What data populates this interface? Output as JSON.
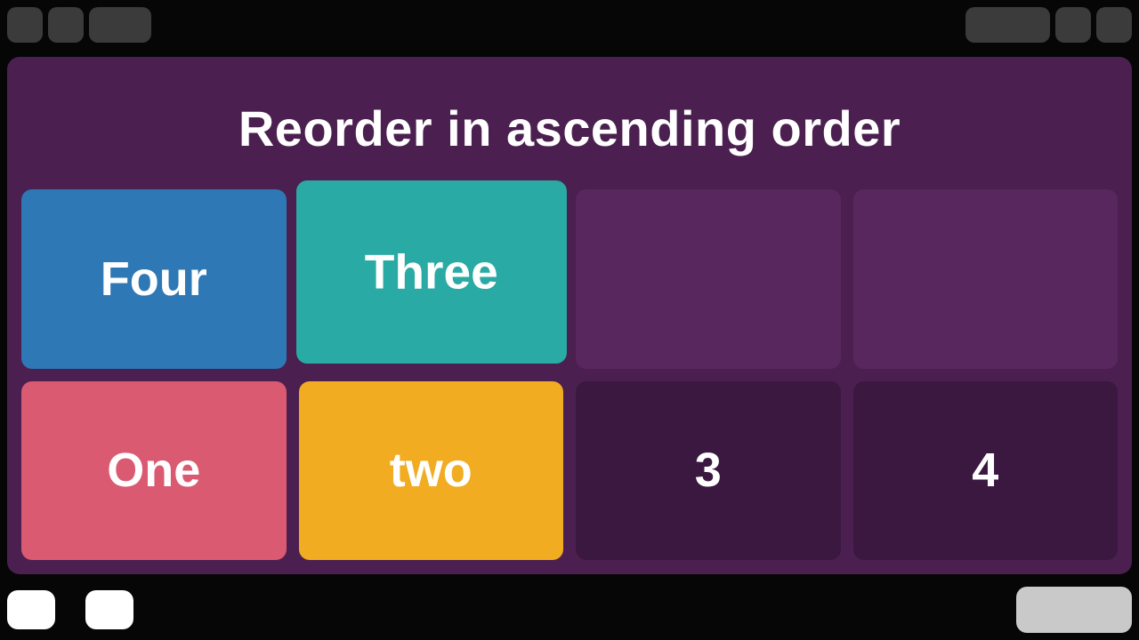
{
  "title": "Reorder in ascending order",
  "colors": {
    "blue": "#2d78b5",
    "teal": "#2aaaa4",
    "pink": "#da5a72",
    "gold": "#f1ac22"
  },
  "top_row": [
    {
      "label": "Four",
      "color": "blue",
      "kind": "draggable"
    },
    {
      "label": "Three",
      "color": "teal",
      "kind": "draggable",
      "pop": true
    },
    {
      "label": "",
      "kind": "slot-mid"
    },
    {
      "label": "",
      "kind": "slot-mid"
    }
  ],
  "bottom_row": [
    {
      "label": "One",
      "color": "pink",
      "kind": "draggable"
    },
    {
      "label": "two",
      "color": "gold",
      "kind": "draggable"
    },
    {
      "label": "3",
      "kind": "slot-dark"
    },
    {
      "label": "4",
      "kind": "slot-dark"
    }
  ]
}
